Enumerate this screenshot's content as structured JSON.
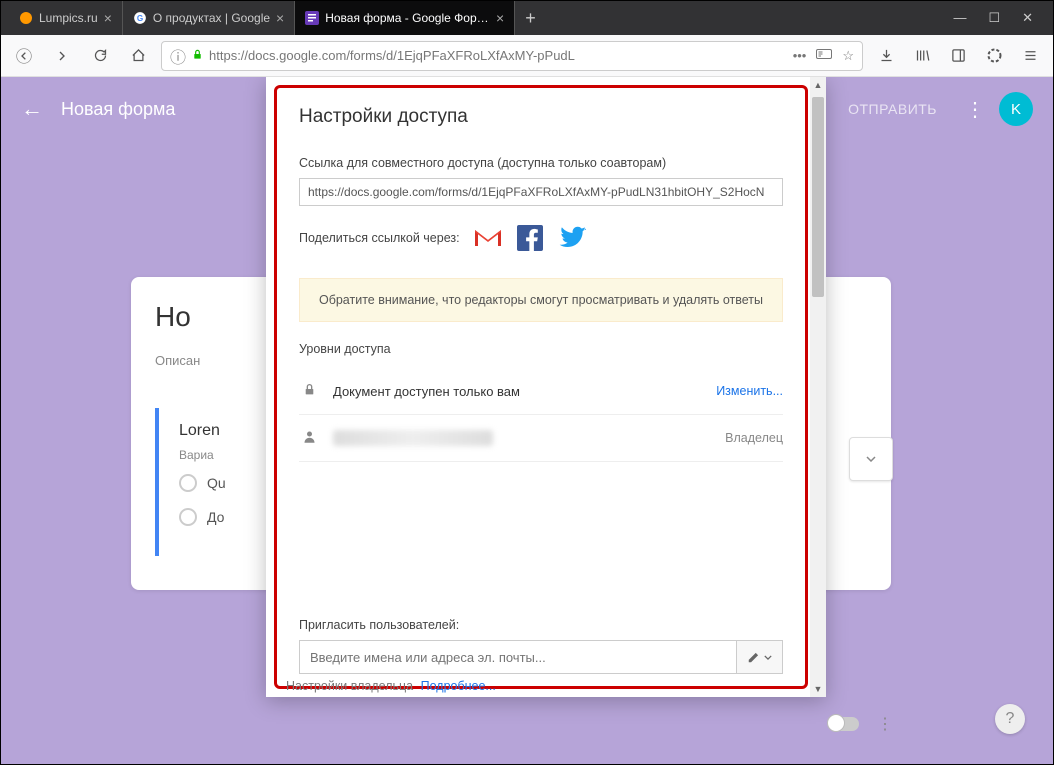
{
  "browser": {
    "tabs": [
      {
        "label": "Lumpics.ru",
        "favicon_color": "#ff9800"
      },
      {
        "label": "О продуктах | Google",
        "favicon": "G"
      },
      {
        "label": "Новая форма - Google Форм…",
        "favicon": "≡"
      }
    ],
    "url": "https://docs.google.com/forms/d/1EjqPFaXFRoLXfAxMY-pPudL"
  },
  "app": {
    "title": "Новая форма",
    "send_label": "ОТПРАВИТЬ",
    "avatar_initial": "K",
    "form_title": "Но",
    "form_desc": "Описан",
    "question_title": "Loren",
    "answer_label": "Вариа",
    "option1": "Qu",
    "option2": "До"
  },
  "modal": {
    "title": "Настройки доступа",
    "link_label": "Ссылка для совместного доступа (доступна только соавторам)",
    "link_value": "https://docs.google.com/forms/d/1EjqPFaXFRoLXfAxMY-pPudLN31hbitOHY_S2HocN",
    "share_label": "Поделиться ссылкой через:",
    "notice": "Обратите внимание, что редакторы смогут просматривать и удалять ответы",
    "access_levels_label": "Уровни доступа",
    "private_text": "Документ доступен только вам",
    "change_label": "Изменить...",
    "owner_role": "Владелец",
    "invite_label": "Пригласить пользователей:",
    "invite_placeholder": "Введите имена или адреса эл. почты...",
    "owner_settings": "Настройки владельца",
    "more_label": "Подробнее..."
  }
}
